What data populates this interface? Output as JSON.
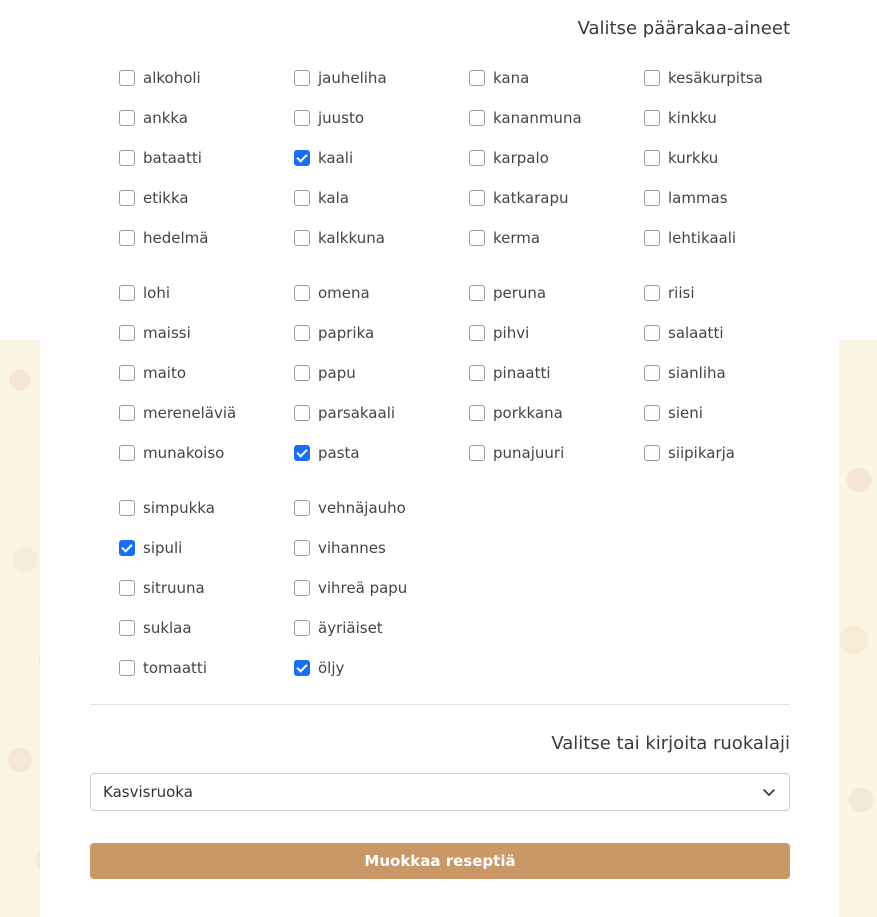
{
  "ingredients_title": "Valitse päärakaa-aineet",
  "groups": [
    [
      [
        "alkoholi",
        false
      ],
      [
        "jauheliha",
        false
      ],
      [
        "kana",
        false
      ],
      [
        "kesäkurpitsa",
        false
      ],
      [
        "ankka",
        false
      ],
      [
        "juusto",
        false
      ],
      [
        "kananmuna",
        false
      ],
      [
        "kinkku",
        false
      ],
      [
        "bataatti",
        false
      ],
      [
        "kaali",
        true
      ],
      [
        "karpalo",
        false
      ],
      [
        "kurkku",
        false
      ],
      [
        "etikka",
        false
      ],
      [
        "kala",
        false
      ],
      [
        "katkarapu",
        false
      ],
      [
        "lammas",
        false
      ],
      [
        "hedelmä",
        false
      ],
      [
        "kalkkuna",
        false
      ],
      [
        "kerma",
        false
      ],
      [
        "lehtikaali",
        false
      ]
    ],
    [
      [
        "lohi",
        false
      ],
      [
        "omena",
        false
      ],
      [
        "peruna",
        false
      ],
      [
        "riisi",
        false
      ],
      [
        "maissi",
        false
      ],
      [
        "paprika",
        false
      ],
      [
        "pihvi",
        false
      ],
      [
        "salaatti",
        false
      ],
      [
        "maito",
        false
      ],
      [
        "papu",
        false
      ],
      [
        "pinaatti",
        false
      ],
      [
        "sianliha",
        false
      ],
      [
        "mereneläviä",
        false
      ],
      [
        "parsakaali",
        false
      ],
      [
        "porkkana",
        false
      ],
      [
        "sieni",
        false
      ],
      [
        "munakoiso",
        false
      ],
      [
        "pasta",
        true
      ],
      [
        "punajuuri",
        false
      ],
      [
        "siipikarja",
        false
      ]
    ],
    [
      [
        "simpukka",
        false
      ],
      [
        "vehnäjauho",
        false
      ],
      null,
      null,
      [
        "sipuli",
        true
      ],
      [
        "vihannes",
        false
      ],
      null,
      null,
      [
        "sitruuna",
        false
      ],
      [
        "vihreä papu",
        false
      ],
      null,
      null,
      [
        "suklaa",
        false
      ],
      [
        "äyriäiset",
        false
      ],
      null,
      null,
      [
        "tomaatti",
        false
      ],
      [
        "öljy",
        true
      ],
      null,
      null
    ]
  ],
  "category_title": "Valitse tai kirjoita ruokalaji",
  "category_value": "Kasvisruoka",
  "submit_label": "Muokkaa reseptiä",
  "colors": {
    "accent": "#c99866",
    "checkbox": "#1a6ef5",
    "background": "#fbf6e4"
  },
  "icons": {
    "select": "chevron-down-icon"
  }
}
